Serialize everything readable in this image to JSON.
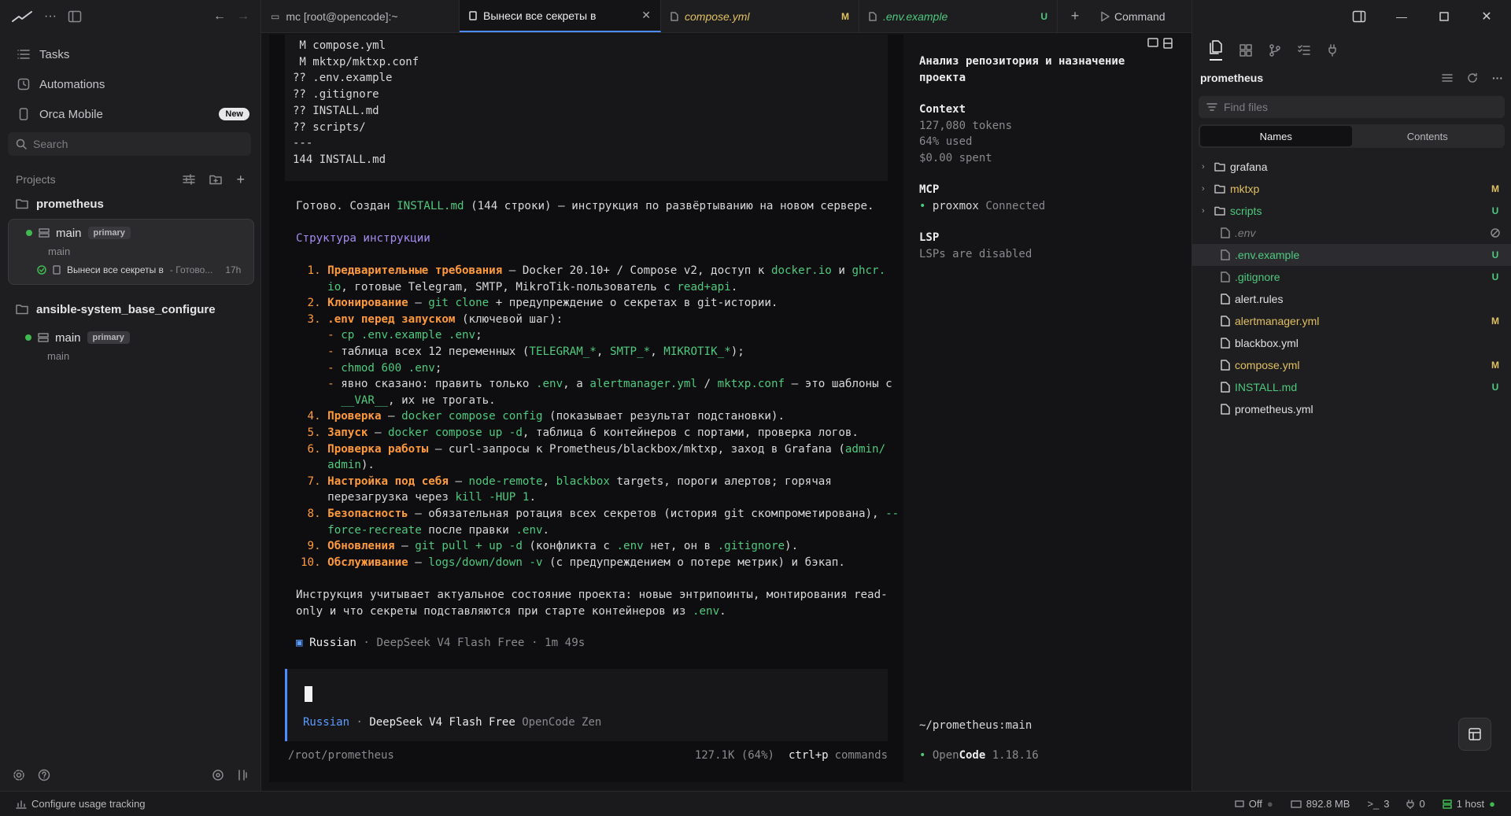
{
  "sidebar": {
    "nav": [
      {
        "label": "Tasks",
        "icon": "list-icon"
      },
      {
        "label": "Automations",
        "icon": "clock-icon"
      },
      {
        "label": "Orca Mobile",
        "icon": "phone-icon",
        "badge": "New"
      }
    ],
    "search_placeholder": "Search",
    "projects_label": "Projects",
    "projects": [
      {
        "name": "prometheus",
        "workspace": {
          "branch": "main",
          "tag": "primary",
          "sub": "main",
          "task": "Вынеси все секреты в",
          "task_status": " - Готово...",
          "task_time": "17h"
        }
      },
      {
        "name": "ansible-system_base_configure",
        "workspace": {
          "branch": "main",
          "tag": "primary",
          "sub": "main"
        }
      }
    ]
  },
  "tabs": [
    {
      "label": "mc [root@opencode]:~",
      "icon": "terminal-icon"
    },
    {
      "label": "Вынеси все секреты в",
      "icon": "chat-icon",
      "active": true
    },
    {
      "label": "compose.yml",
      "icon": "file-icon",
      "status": "M"
    },
    {
      "label": ".env.example",
      "icon": "file-icon",
      "status": "U"
    }
  ],
  "command_label": "Command",
  "terminal": {
    "code": [
      " M compose.yml",
      " M mktxp/mktxp.conf",
      "?? .env.example",
      "?? .gitignore",
      "?? INSTALL.md",
      "?? scripts/",
      "---",
      "144 INSTALL.md"
    ],
    "done_prefix": "Готово. Создан ",
    "done_file": "INSTALL.md",
    "done_suffix": " (144 строки) — инструкция по развёртыванию на новом сервере.",
    "structure_heading": "Структура инструкции",
    "steps": {
      "s1_title": "Предварительные требования",
      "s1_a": " — Docker 20.10+ / Compose v2, доступ к ",
      "s1_b": "docker.io",
      "s1_c": " и ",
      "s1_d": "ghcr.",
      "s1_e": "io",
      "s1_f": ", готовые Telegram, SMTP, MikroTik-пользователь с ",
      "s1_g": "read+api",
      "s1_h": ".",
      "s2_title": "Клонирование",
      "s2_a": " — ",
      "s2_b": "git clone",
      "s2_c": " + предупреждение о секретах в git-истории.",
      "s3_title": ".env перед запуском",
      "s3_a": " (ключевой шаг):",
      "s3_b1": "cp .env.example .env",
      "s3_b1_end": ";",
      "s3_b2a": "таблица всех 12 переменных (",
      "s3_b2b": "TELEGRAM_*",
      "s3_b2c": ", ",
      "s3_b2d": "SMTP_*",
      "s3_b2e": ", ",
      "s3_b2f": "MIKROTIK_*",
      "s3_b2g": ");",
      "s3_b3": "chmod 600 .env",
      "s3_b3_end": ";",
      "s3_b4a": "явно сказано: править только ",
      "s3_b4b": ".env",
      "s3_b4c": ", а ",
      "s3_b4d": "alertmanager.yml",
      "s3_b4e": " / ",
      "s3_b4f": "mktxp.conf",
      "s3_b4g": " — это шаблоны с",
      "s3_b4h": "__VAR__",
      "s3_b4i": ", их не трогать.",
      "s4_title": "Проверка",
      "s4_a": " — ",
      "s4_b": "docker compose config",
      "s4_c": " (показывает результат подстановки).",
      "s5_title": "Запуск",
      "s5_a": " — ",
      "s5_b": "docker compose up -d",
      "s5_c": ", таблица 6 контейнеров с портами, проверка логов.",
      "s6_title": "Проверка работы",
      "s6_a": " — curl-запросы к Prometheus/blackbox/mktxp, заход в Grafana (",
      "s6_b": "admin/",
      "s6_c": "admin",
      "s6_d": ").",
      "s7_title": "Настройка под себя",
      "s7_a": " — ",
      "s7_b": "node-remote",
      "s7_c": ", ",
      "s7_d": "blackbox",
      "s7_e": " targets, пороги алертов; горячая",
      "s7_f": "перезагрузка через ",
      "s7_g": "kill -HUP 1",
      "s7_h": ".",
      "s8_title": "Безопасность",
      "s8_a": " — обязательная ротация всех секретов (история git скомпрометирована), ",
      "s8_b": "--",
      "s8_c": "force-recreate",
      "s8_d": " после правки ",
      "s8_e": ".env",
      "s8_f": ".",
      "s9_title": "Обновления",
      "s9_a": " — ",
      "s9_b": "git pull + up -d",
      "s9_c": " (конфликта с ",
      "s9_d": ".env",
      "s9_e": " нет, он в ",
      "s9_f": ".gitignore",
      "s9_g": ").",
      "s10_title": "Обслуживание",
      "s10_a": " — ",
      "s10_b": "logs/down/down -v",
      "s10_c": " (с предупреждением о потере метрик) и бэкап."
    },
    "note_line1a": "Инструкция учитывает актуальное состояние проекта: новые энтрипоинты, монтирования read-",
    "note_line2a": "only и что секреты подставляются при старте контейнеров из ",
    "note_line2b": ".env",
    "note_line2c": ".",
    "meta_lang": "Russian",
    "meta_rest": " · DeepSeek V4 Flash Free · 1m 49s",
    "input_lang": "Russian",
    "input_model": "DeepSeek V4 Flash Free",
    "input_provider": "OpenCode Zen",
    "path": "/root/prometheus",
    "usage": "127.1K (64%)",
    "shortcut_key": "ctrl+p",
    "shortcut_label": "commands"
  },
  "session": {
    "title_line1": "Анализ репозитория и назначение",
    "title_line2": "проекта",
    "context_label": "Context",
    "tokens": "127,080 tokens",
    "used": "64% used",
    "spent": "$0.00 spent",
    "mcp_label": "MCP",
    "mcp_server": "proxmox",
    "mcp_status": "Connected",
    "lsp_label": "LSP",
    "lsp_status": "LSPs are disabled",
    "cwd": "~/prometheus:main",
    "app_a": "Open",
    "app_b": "Code",
    "app_version": "1.18.16"
  },
  "explorer": {
    "title": "prometheus",
    "find_placeholder": "Find files",
    "seg_names": "Names",
    "seg_contents": "Contents",
    "items": [
      {
        "name": "grafana",
        "type": "folder",
        "status": "",
        "color": "#e0e0e2"
      },
      {
        "name": "mktxp",
        "type": "folder",
        "status": "M",
        "color": "#e0c060"
      },
      {
        "name": "scripts",
        "type": "folder",
        "status": "U",
        "color": "#4ec97e"
      },
      {
        "name": ".env",
        "type": "file",
        "status": "",
        "color": "#7d7d82"
      },
      {
        "name": ".env.example",
        "type": "file",
        "status": "U",
        "color": "#4ec97e"
      },
      {
        "name": ".gitignore",
        "type": "file",
        "status": "U",
        "color": "#4ec97e"
      },
      {
        "name": "alert.rules",
        "type": "file",
        "status": "",
        "color": "#e0e0e2"
      },
      {
        "name": "alertmanager.yml",
        "type": "file",
        "status": "M",
        "color": "#e0c060"
      },
      {
        "name": "blackbox.yml",
        "type": "file",
        "status": "",
        "color": "#e0e0e2"
      },
      {
        "name": "compose.yml",
        "type": "file",
        "status": "M",
        "color": "#e0c060"
      },
      {
        "name": "INSTALL.md",
        "type": "file",
        "status": "U",
        "color": "#4ec97e"
      },
      {
        "name": "prometheus.yml",
        "type": "file",
        "status": "",
        "color": "#e0e0e2"
      }
    ]
  },
  "statusbar": {
    "usage_tracking": "Configure usage tracking",
    "off": "Off",
    "memory": "892.8 MB",
    "terminals": "3",
    "ports": "0",
    "hosts": "1 host"
  },
  "colors": {
    "accent": "#4c8dff",
    "green": "#4ec97e",
    "orange": "#ff9a3c",
    "purple": "#a48cf0",
    "modified": "#e0c060"
  }
}
